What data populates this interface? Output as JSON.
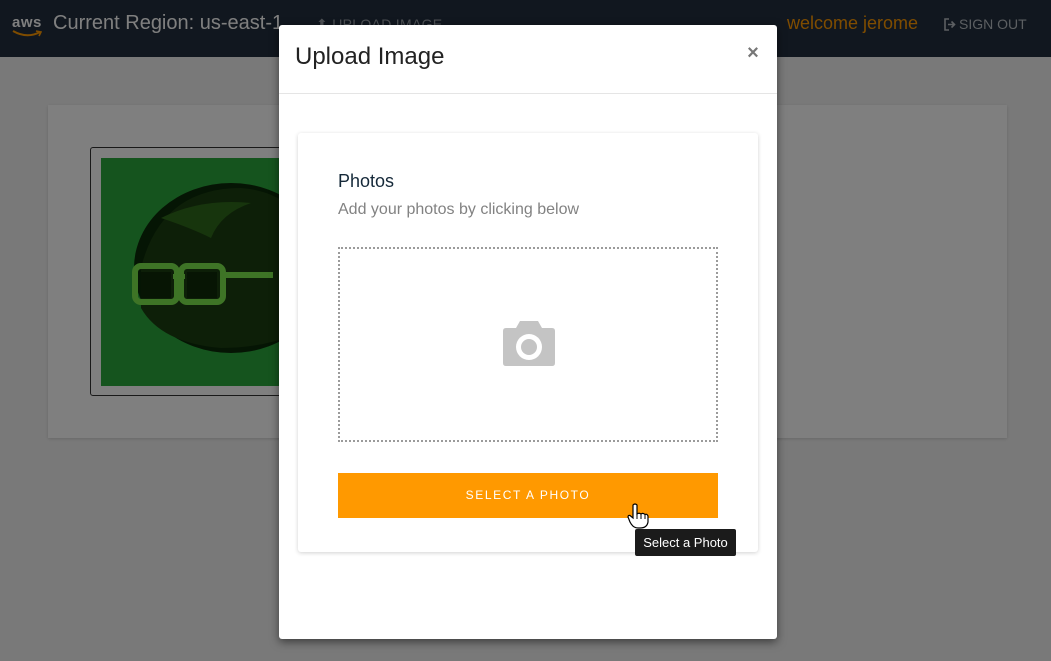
{
  "nav": {
    "logo_text": "aws",
    "region_label": "Current Region: us-east-1",
    "upload_label": "UPLOAD IMAGE",
    "welcome_text": "welcome jerome",
    "signout_label": "SIGN OUT",
    "colors": {
      "bar": "#232f3e",
      "accent": "#ff9900"
    }
  },
  "background": {
    "thumbnail_icon": "person-glasses-image"
  },
  "modal": {
    "title": "Upload Image",
    "close_label": "×",
    "photos_title": "Photos",
    "photos_subtitle": "Add your photos by clicking below",
    "dropzone_icon": "camera-icon",
    "select_button_label": "SELECT A PHOTO",
    "tooltip": "Select a Photo",
    "colors": {
      "button": "#ff9900"
    }
  }
}
